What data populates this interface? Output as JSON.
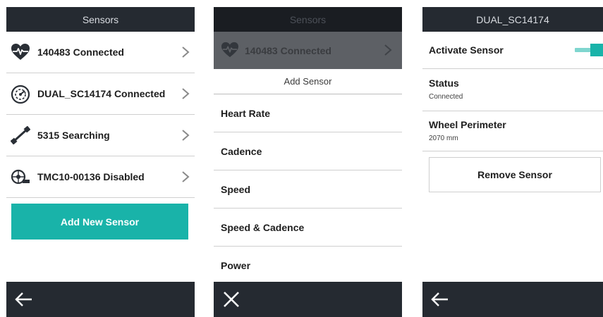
{
  "screen1": {
    "title": "Sensors",
    "sensors": [
      {
        "label": "140483 Connected",
        "icon": "heart-rate-icon"
      },
      {
        "label": "DUAL_SC14174 Connected",
        "icon": "speed-cadence-icon"
      },
      {
        "label": "5315 Searching",
        "icon": "power-icon"
      },
      {
        "label": "TMC10-00136 Disabled",
        "icon": "trainer-icon"
      }
    ],
    "add_button": "Add New Sensor",
    "back_icon": "back-arrow-icon"
  },
  "screen2": {
    "title": "Sensors",
    "overlay_row_label": "140483 Connected",
    "sheet_title": "Add Sensor",
    "options": [
      "Heart Rate",
      "Cadence",
      "Speed",
      "Speed & Cadence",
      "Power"
    ],
    "close_icon": "close-icon"
  },
  "screen3": {
    "title": "DUAL_SC14174",
    "activate_label": "Activate Sensor",
    "activate_on": true,
    "status_label": "Status",
    "status_value": "Connected",
    "wheel_label": "Wheel Perimeter",
    "wheel_value": "2070 mm",
    "remove_button": "Remove Sensor",
    "back_icon": "back-arrow-icon"
  },
  "colors": {
    "dark_bar": "#252a31",
    "accent": "#19b3a9",
    "toggle_track": "#7fd6cf",
    "divider": "#cfcfcf"
  }
}
